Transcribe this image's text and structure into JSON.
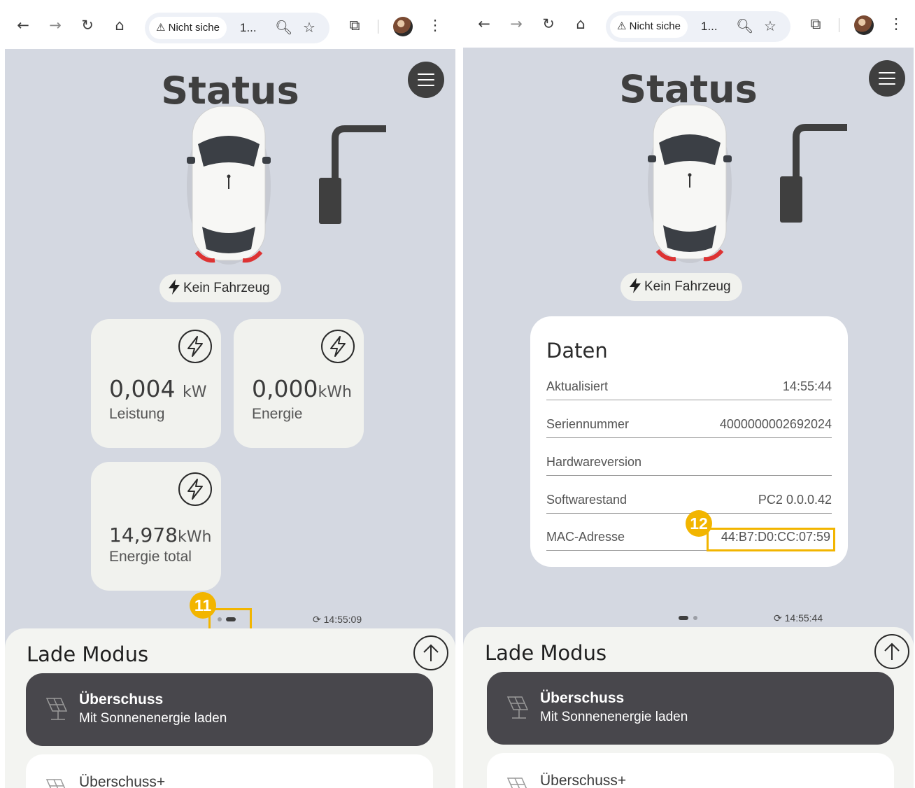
{
  "browser": {
    "security_label": "Nicht siche",
    "url": "1..."
  },
  "left": {
    "title": "Status",
    "vehicle_status": "Kein Fahrzeug",
    "cards": [
      {
        "value": "0,004",
        "unit": "kW",
        "label": "Leistung",
        "icon": "bolt-circle-icon"
      },
      {
        "value": "0,000",
        "unit": "kWh",
        "label": "Energie",
        "icon": "bolt-circle-icon"
      },
      {
        "value": "14,978",
        "unit": "kWh",
        "label": "Energie total",
        "icon": "bolt-circle-icon"
      }
    ],
    "pager": {
      "pages": 2,
      "active_page": 2
    },
    "refresh_time": "14:55:09",
    "annotation_badge": "11"
  },
  "right": {
    "title": "Status",
    "vehicle_status": "Kein Fahrzeug",
    "data_panel": {
      "title": "Daten",
      "rows": [
        {
          "key": "Aktualisiert",
          "value": "14:55:44"
        },
        {
          "key": "Seriennummer",
          "value": "4000000002692024"
        },
        {
          "key": "Hardwareversion",
          "value": ""
        },
        {
          "key": "Softwarestand",
          "value": "PC2 0.0.0.42"
        },
        {
          "key": "MAC-Adresse",
          "value": "44:B7:D0:CC:07:59"
        }
      ]
    },
    "pager": {
      "pages": 2,
      "active_page": 1
    },
    "refresh_time": "14:55:44",
    "annotation_badge": "12"
  },
  "charging_mode": {
    "title": "Lade Modus",
    "modes": [
      {
        "name": "Überschuss",
        "description": "Mit Sonnenenergie laden",
        "selected": true
      },
      {
        "name": "Überschuss+",
        "description": "",
        "selected": false
      }
    ]
  },
  "colors": {
    "background": "#d4d8e1",
    "card": "#f1f2ee",
    "selected_mode": "#48474c",
    "highlight": "#f2b500",
    "text_dark": "#3f3f3f"
  }
}
